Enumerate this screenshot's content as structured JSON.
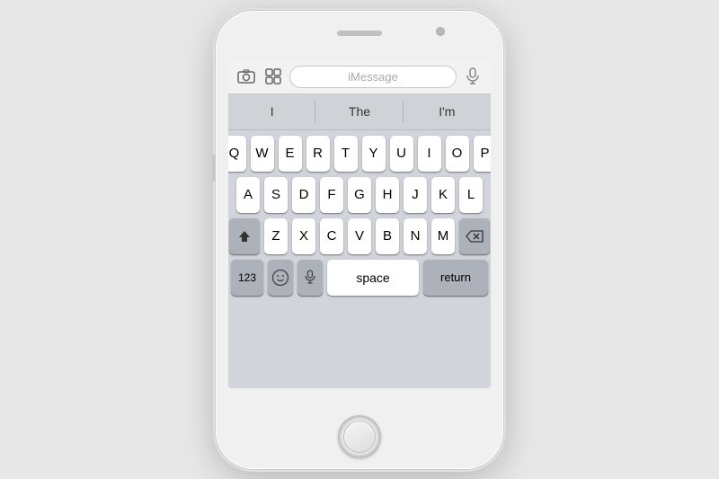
{
  "phone": {
    "toolbar": {
      "placeholder": "iMessage",
      "camera_icon": "📷",
      "apps_icon": "⊞",
      "mic_icon": "🎤"
    },
    "predictive": {
      "items": [
        "I",
        "The",
        "I'm"
      ]
    },
    "keyboard": {
      "row1": [
        "Q",
        "W",
        "E",
        "R",
        "T",
        "Y",
        "U",
        "I",
        "O",
        "P"
      ],
      "row2": [
        "A",
        "S",
        "D",
        "F",
        "G",
        "H",
        "J",
        "K",
        "L"
      ],
      "row3": [
        "Z",
        "X",
        "C",
        "V",
        "B",
        "N",
        "M"
      ],
      "bottom": {
        "num_label": "123",
        "space_label": "space",
        "return_label": "return"
      }
    },
    "chevron": "‹"
  }
}
